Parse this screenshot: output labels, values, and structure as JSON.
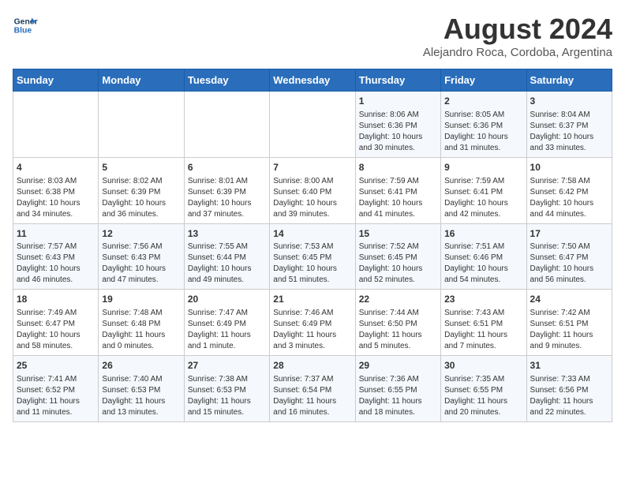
{
  "header": {
    "logo_line1": "General",
    "logo_line2": "Blue",
    "month_title": "August 2024",
    "subtitle": "Alejandro Roca, Cordoba, Argentina"
  },
  "days_of_week": [
    "Sunday",
    "Monday",
    "Tuesday",
    "Wednesday",
    "Thursday",
    "Friday",
    "Saturday"
  ],
  "weeks": [
    [
      {
        "day": "",
        "info": ""
      },
      {
        "day": "",
        "info": ""
      },
      {
        "day": "",
        "info": ""
      },
      {
        "day": "",
        "info": ""
      },
      {
        "day": "1",
        "info": "Sunrise: 8:06 AM\nSunset: 6:36 PM\nDaylight: 10 hours\nand 30 minutes."
      },
      {
        "day": "2",
        "info": "Sunrise: 8:05 AM\nSunset: 6:36 PM\nDaylight: 10 hours\nand 31 minutes."
      },
      {
        "day": "3",
        "info": "Sunrise: 8:04 AM\nSunset: 6:37 PM\nDaylight: 10 hours\nand 33 minutes."
      }
    ],
    [
      {
        "day": "4",
        "info": "Sunrise: 8:03 AM\nSunset: 6:38 PM\nDaylight: 10 hours\nand 34 minutes."
      },
      {
        "day": "5",
        "info": "Sunrise: 8:02 AM\nSunset: 6:39 PM\nDaylight: 10 hours\nand 36 minutes."
      },
      {
        "day": "6",
        "info": "Sunrise: 8:01 AM\nSunset: 6:39 PM\nDaylight: 10 hours\nand 37 minutes."
      },
      {
        "day": "7",
        "info": "Sunrise: 8:00 AM\nSunset: 6:40 PM\nDaylight: 10 hours\nand 39 minutes."
      },
      {
        "day": "8",
        "info": "Sunrise: 7:59 AM\nSunset: 6:41 PM\nDaylight: 10 hours\nand 41 minutes."
      },
      {
        "day": "9",
        "info": "Sunrise: 7:59 AM\nSunset: 6:41 PM\nDaylight: 10 hours\nand 42 minutes."
      },
      {
        "day": "10",
        "info": "Sunrise: 7:58 AM\nSunset: 6:42 PM\nDaylight: 10 hours\nand 44 minutes."
      }
    ],
    [
      {
        "day": "11",
        "info": "Sunrise: 7:57 AM\nSunset: 6:43 PM\nDaylight: 10 hours\nand 46 minutes."
      },
      {
        "day": "12",
        "info": "Sunrise: 7:56 AM\nSunset: 6:43 PM\nDaylight: 10 hours\nand 47 minutes."
      },
      {
        "day": "13",
        "info": "Sunrise: 7:55 AM\nSunset: 6:44 PM\nDaylight: 10 hours\nand 49 minutes."
      },
      {
        "day": "14",
        "info": "Sunrise: 7:53 AM\nSunset: 6:45 PM\nDaylight: 10 hours\nand 51 minutes."
      },
      {
        "day": "15",
        "info": "Sunrise: 7:52 AM\nSunset: 6:45 PM\nDaylight: 10 hours\nand 52 minutes."
      },
      {
        "day": "16",
        "info": "Sunrise: 7:51 AM\nSunset: 6:46 PM\nDaylight: 10 hours\nand 54 minutes."
      },
      {
        "day": "17",
        "info": "Sunrise: 7:50 AM\nSunset: 6:47 PM\nDaylight: 10 hours\nand 56 minutes."
      }
    ],
    [
      {
        "day": "18",
        "info": "Sunrise: 7:49 AM\nSunset: 6:47 PM\nDaylight: 10 hours\nand 58 minutes."
      },
      {
        "day": "19",
        "info": "Sunrise: 7:48 AM\nSunset: 6:48 PM\nDaylight: 11 hours\nand 0 minutes."
      },
      {
        "day": "20",
        "info": "Sunrise: 7:47 AM\nSunset: 6:49 PM\nDaylight: 11 hours\nand 1 minute."
      },
      {
        "day": "21",
        "info": "Sunrise: 7:46 AM\nSunset: 6:49 PM\nDaylight: 11 hours\nand 3 minutes."
      },
      {
        "day": "22",
        "info": "Sunrise: 7:44 AM\nSunset: 6:50 PM\nDaylight: 11 hours\nand 5 minutes."
      },
      {
        "day": "23",
        "info": "Sunrise: 7:43 AM\nSunset: 6:51 PM\nDaylight: 11 hours\nand 7 minutes."
      },
      {
        "day": "24",
        "info": "Sunrise: 7:42 AM\nSunset: 6:51 PM\nDaylight: 11 hours\nand 9 minutes."
      }
    ],
    [
      {
        "day": "25",
        "info": "Sunrise: 7:41 AM\nSunset: 6:52 PM\nDaylight: 11 hours\nand 11 minutes."
      },
      {
        "day": "26",
        "info": "Sunrise: 7:40 AM\nSunset: 6:53 PM\nDaylight: 11 hours\nand 13 minutes."
      },
      {
        "day": "27",
        "info": "Sunrise: 7:38 AM\nSunset: 6:53 PM\nDaylight: 11 hours\nand 15 minutes."
      },
      {
        "day": "28",
        "info": "Sunrise: 7:37 AM\nSunset: 6:54 PM\nDaylight: 11 hours\nand 16 minutes."
      },
      {
        "day": "29",
        "info": "Sunrise: 7:36 AM\nSunset: 6:55 PM\nDaylight: 11 hours\nand 18 minutes."
      },
      {
        "day": "30",
        "info": "Sunrise: 7:35 AM\nSunset: 6:55 PM\nDaylight: 11 hours\nand 20 minutes."
      },
      {
        "day": "31",
        "info": "Sunrise: 7:33 AM\nSunset: 6:56 PM\nDaylight: 11 hours\nand 22 minutes."
      }
    ]
  ]
}
